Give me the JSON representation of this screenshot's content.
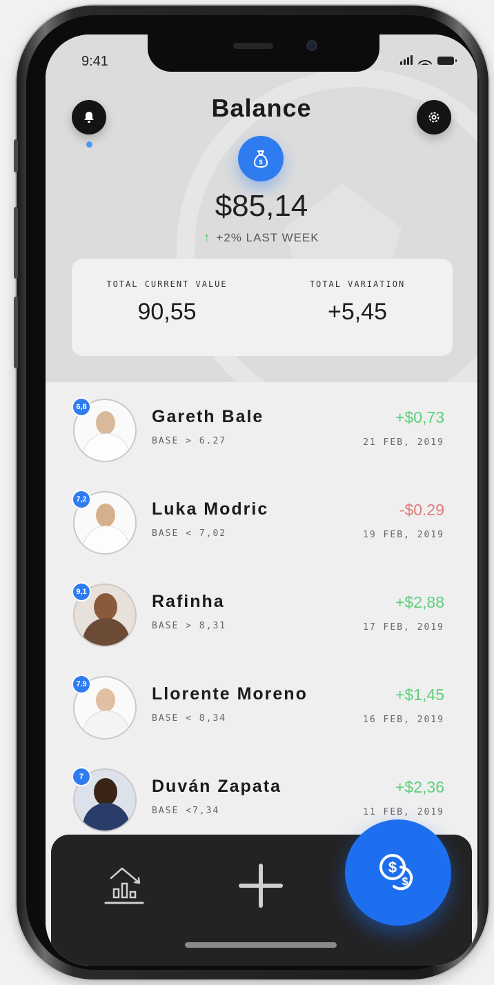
{
  "status_bar": {
    "time": "9:41"
  },
  "header": {
    "title": "Balance",
    "balance": "$85,14",
    "change": "+2% LAST WEEK"
  },
  "summary": {
    "current_label": "TOTAL CURRENT VALUE",
    "current_value": "90,55",
    "variation_label": "TOTAL VARIATION",
    "variation_value": "+5,45"
  },
  "players": [
    {
      "rating": "6,8",
      "name": "Gareth Bale",
      "base": "BASE > 6.27",
      "change": "+$0,73",
      "date": "21 FEB, 2019",
      "trend": "up"
    },
    {
      "rating": "7,2",
      "name": "Luka Modric",
      "base": "BASE < 7,02",
      "change": "-$0.29",
      "date": "19 FEB, 2019",
      "trend": "down"
    },
    {
      "rating": "9,1",
      "name": "Rafinha",
      "base": "BASE > 8,31",
      "change": "+$2,88",
      "date": "17 FEB, 2019",
      "trend": "up"
    },
    {
      "rating": "7.9",
      "name": "Llorente Moreno",
      "base": "BASE < 8,34",
      "change": "+$1,45",
      "date": "16 FEB, 2019",
      "trend": "up"
    },
    {
      "rating": "7",
      "name": "Duván Zapata",
      "base": "BASE <7,34",
      "change": "+$2,36",
      "date": "11 FEB, 2019",
      "trend": "up"
    }
  ],
  "icons": {
    "notifications": "bell-icon",
    "settings": "gear-icon",
    "money": "money-bag-icon",
    "stats_tab": "stats-icon",
    "add_tab": "plus-icon",
    "coins_tab": "coins-icon"
  },
  "colors": {
    "accent": "#2f7cf0",
    "positive": "#5cd07a",
    "negative": "#e07a7a",
    "tabbar": "#232323"
  }
}
